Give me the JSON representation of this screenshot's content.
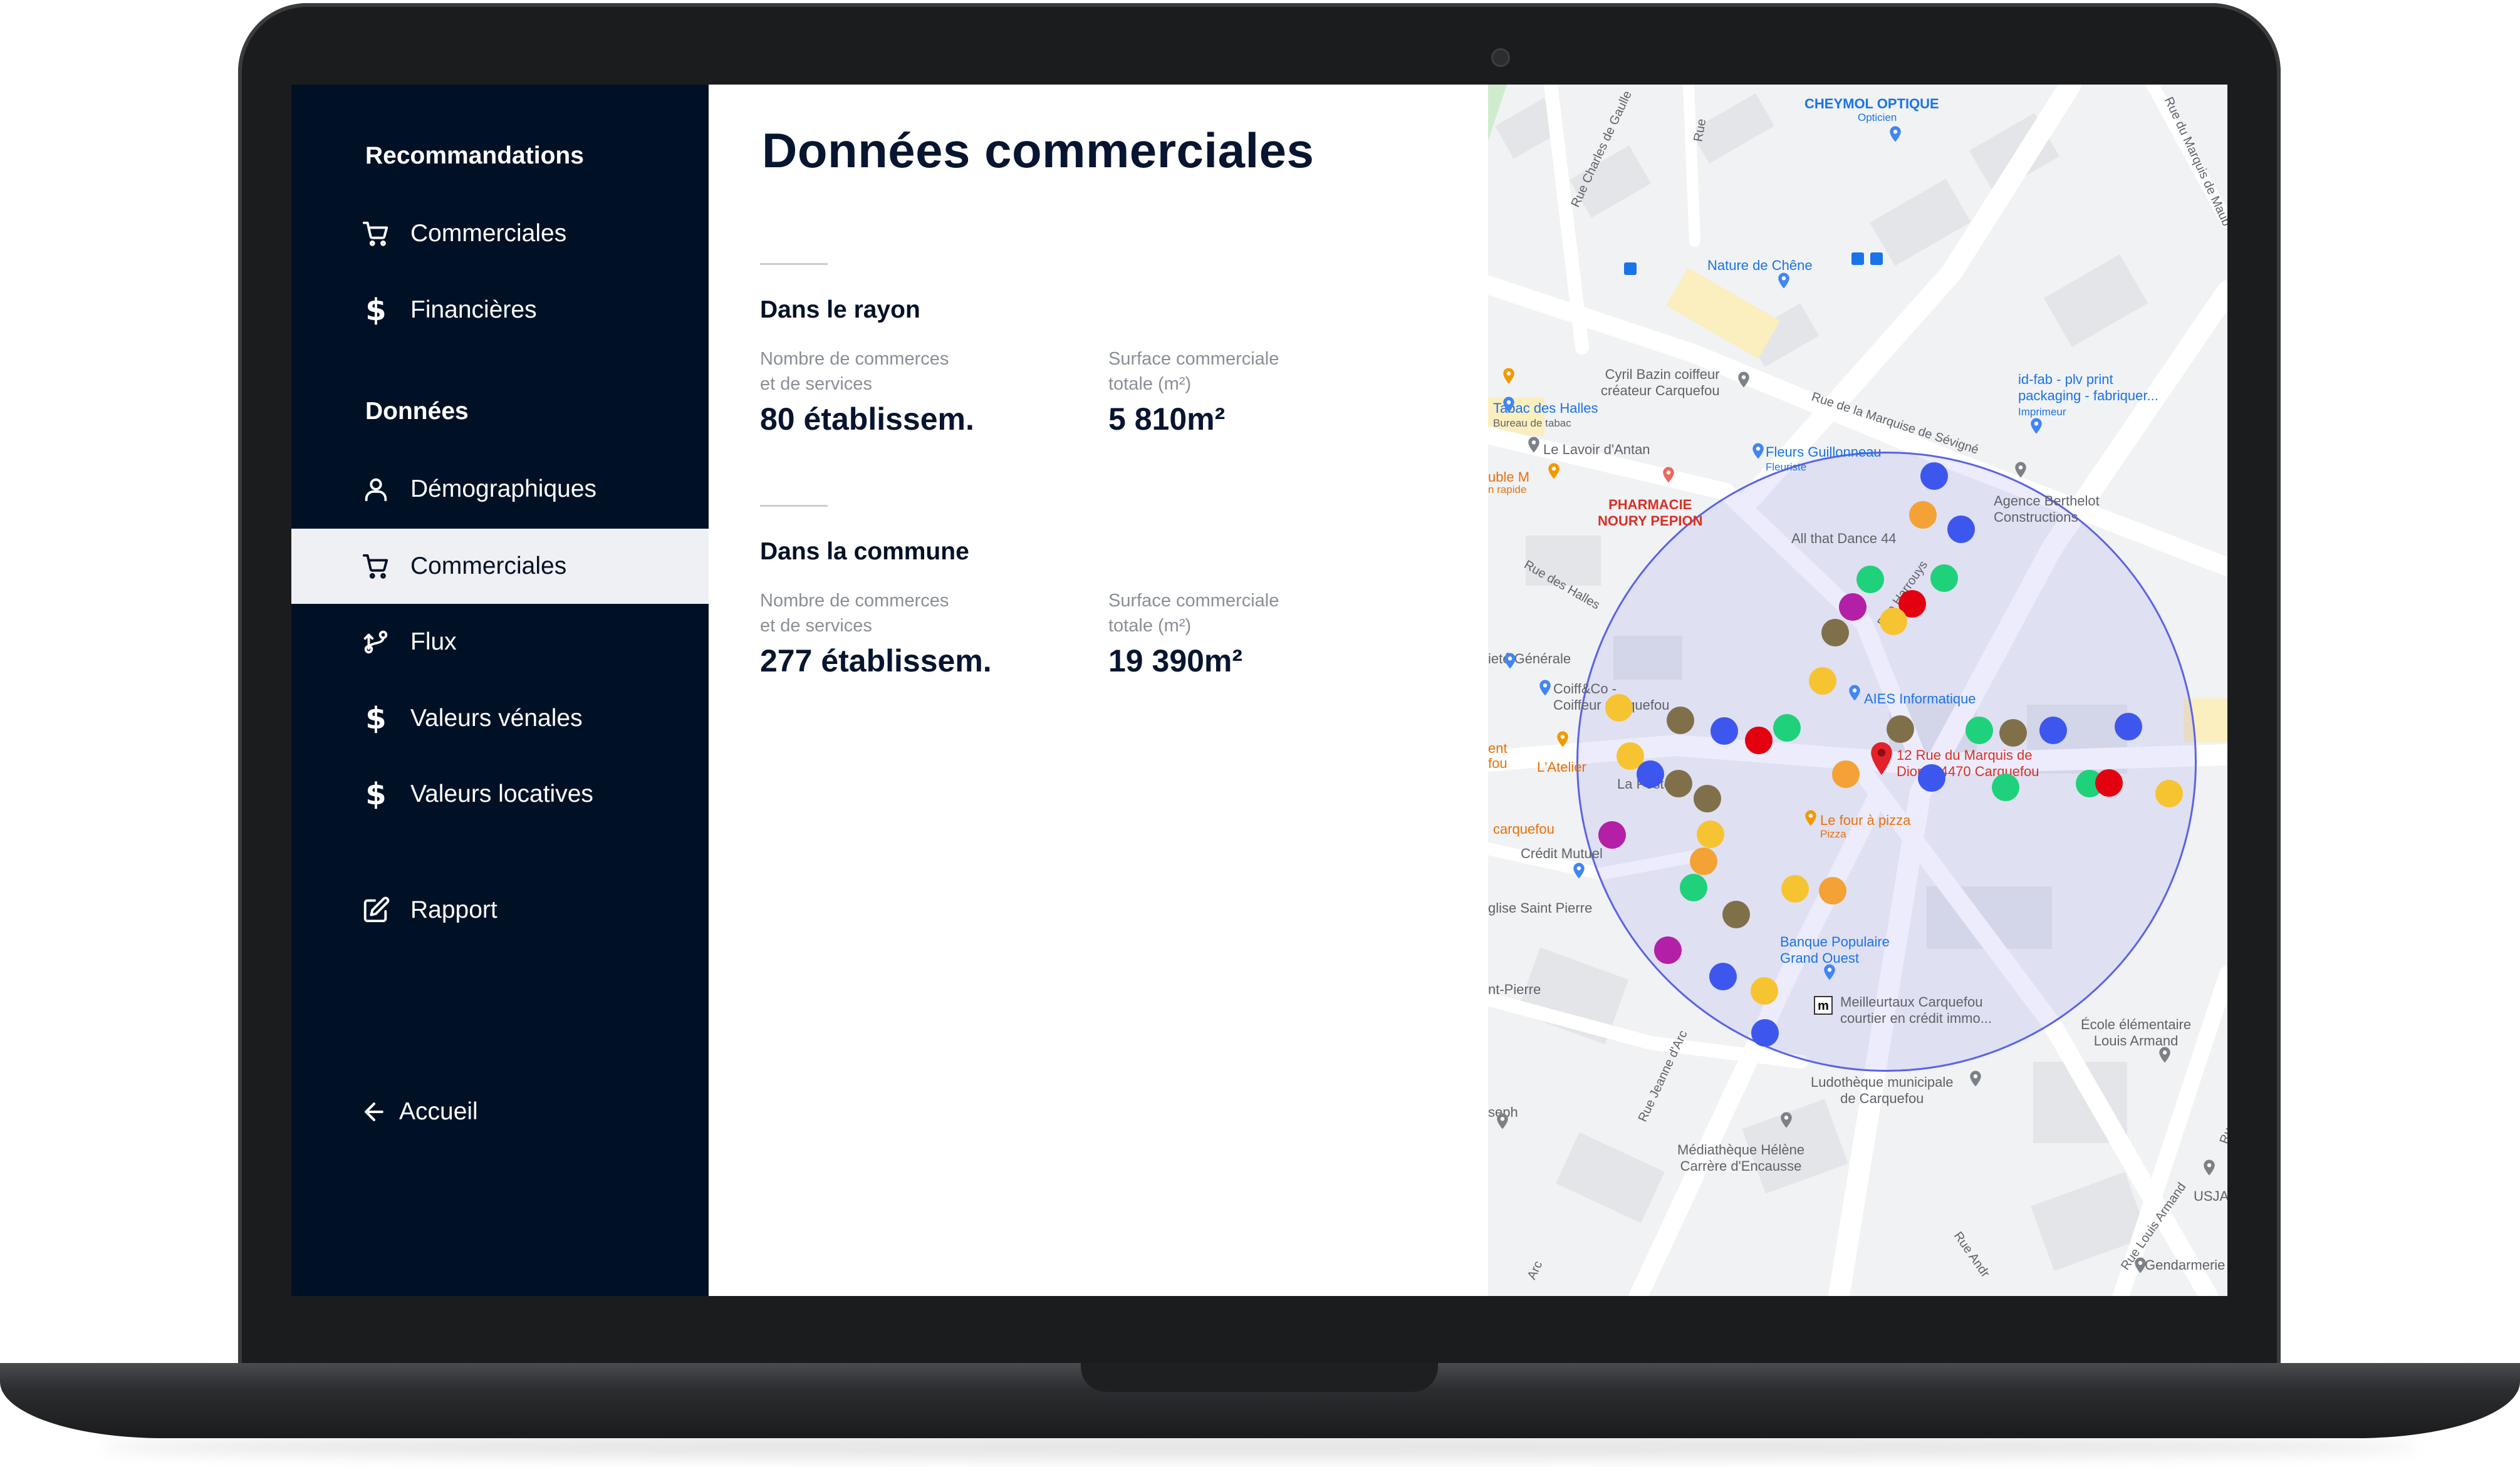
{
  "sidebar": {
    "section_recommandations": "Recommandations",
    "recommandations_items": [
      {
        "label": "Commerciales",
        "icon": "cart-icon"
      },
      {
        "label": "Financières",
        "icon": "dollar-icon"
      }
    ],
    "section_donnees": "Données",
    "donnees_items": [
      {
        "label": "Démographiques",
        "icon": "user-icon"
      },
      {
        "label": "Commerciales",
        "icon": "cart-icon",
        "active": true
      },
      {
        "label": "Flux",
        "icon": "flow-icon"
      },
      {
        "label": "Valeurs vénales",
        "icon": "dollar-icon"
      },
      {
        "label": "Valeurs locatives",
        "icon": "dollar-icon"
      }
    ],
    "rapport": {
      "label": "Rapport",
      "icon": "edit-icon"
    },
    "back": {
      "label": "Accueil",
      "icon": "arrow-left-icon"
    }
  },
  "main": {
    "title": "Données commerciales",
    "sections": [
      {
        "title": "Dans le rayon",
        "stats": [
          {
            "label_line1": "Nombre de commerces",
            "label_line2": "et de services",
            "value": "80 établissem."
          },
          {
            "label_line1": "Surface commerciale",
            "label_line2": "totale (m²)",
            "value": "5 810m²"
          }
        ]
      },
      {
        "title": "Dans la commune",
        "stats": [
          {
            "label_line1": "Nombre de commerces",
            "label_line2": "et de services",
            "value": "277 établissem."
          },
          {
            "label_line1": "Surface commerciale",
            "label_line2": "totale (m²)",
            "value": "19 390m²"
          }
        ]
      }
    ]
  },
  "map": {
    "labels": {
      "cheymol": "CHEYMOL OPTIQUE",
      "cheymol_sub": "Opticien",
      "nature_chene": "Nature de Chêne",
      "cyril_bazin_1": "Cyril Bazin coiffeur",
      "cyril_bazin_2": "créateur Carquefou",
      "tabac_1": "Tabac des Halles",
      "tabac_2": "Bureau de tabac",
      "lavoir": "Le Lavoir d'Antan",
      "idfab_1": "id-fab - plv print",
      "idfab_2": "packaging - fabriquer...",
      "idfab_3": "Imprimeur",
      "fleurs": "Fleurs Guillonneau",
      "fleurs_sub": "Fleuriste",
      "pharmacie_1": "PHARMACIE",
      "pharmacie_2": "NOURY PEPION",
      "agence_1": "Agence Berthelot",
      "agence_2": "Constructions",
      "all_that_dance": "All that Dance 44",
      "aies": "AIES Informatique",
      "address_1": "12 Rue du Marquis de",
      "address_2": "Dion, 44470 Carquefou",
      "coiff_1": "Coiff&Co -",
      "coiff_2": "Coiffeur Carquefou",
      "latelier": "L'Atelier",
      "la_poste": "La Poste",
      "four_pizza": "Le four à pizza",
      "four_pizza_sub": "Pizza",
      "credit_mutuel": "Crédit Mutuel",
      "carquefou": "carquefou",
      "eglise": "glise Saint Pierre",
      "banque_1": "Banque Populaire",
      "banque_2": "Grand Ouest",
      "meilleurtaux_1": "Meilleurtaux Carquefou",
      "meilleurtaux_2": "courtier en crédit immo...",
      "ecole_1": "École élémentaire",
      "ecole_2": "Louis Armand",
      "ludotheque_1": "Ludothèque municipale",
      "ludotheque_2": "de Carquefou",
      "mediatheque_1": "Médiathèque Hélène",
      "mediatheque_2": "Carrère d'Encausse",
      "gendarmerie": "Gendarmerie",
      "usja": "USJA",
      "seph": "seph",
      "generale": "ieté Générale",
      "double_m": "uble M",
      "double_m_sub": "n rapide",
      "ent": "ent",
      "fou": "fou",
      "nt_pierre": "nt-Pierre"
    },
    "streets": {
      "charles_gaulle": "Rue Charles de Gaulle",
      "marquis_maub": "Rue du Marquis de Maub",
      "marquise_sevigne": "Rue de la Marquise de Sévigné",
      "des_halles": "Rue des Halles",
      "harrouys": "Rue Harrouys",
      "jeanne_arc": "Rue Jeanne d'Arc",
      "louis_armand": "Rue Louis Armand",
      "andre": "Rue Andr",
      "rue_louis_armand2": "Rue Louis Armand",
      "rue_top": "Rue",
      "arc": "Arc"
    },
    "dot_colors": {
      "blue": "#3d57ee",
      "orange": "#f4a235",
      "yellow": "#f7c431",
      "green": "#1fd17b",
      "red": "#e3000f",
      "purple": "#b31fa7",
      "olive": "#80704a"
    }
  }
}
